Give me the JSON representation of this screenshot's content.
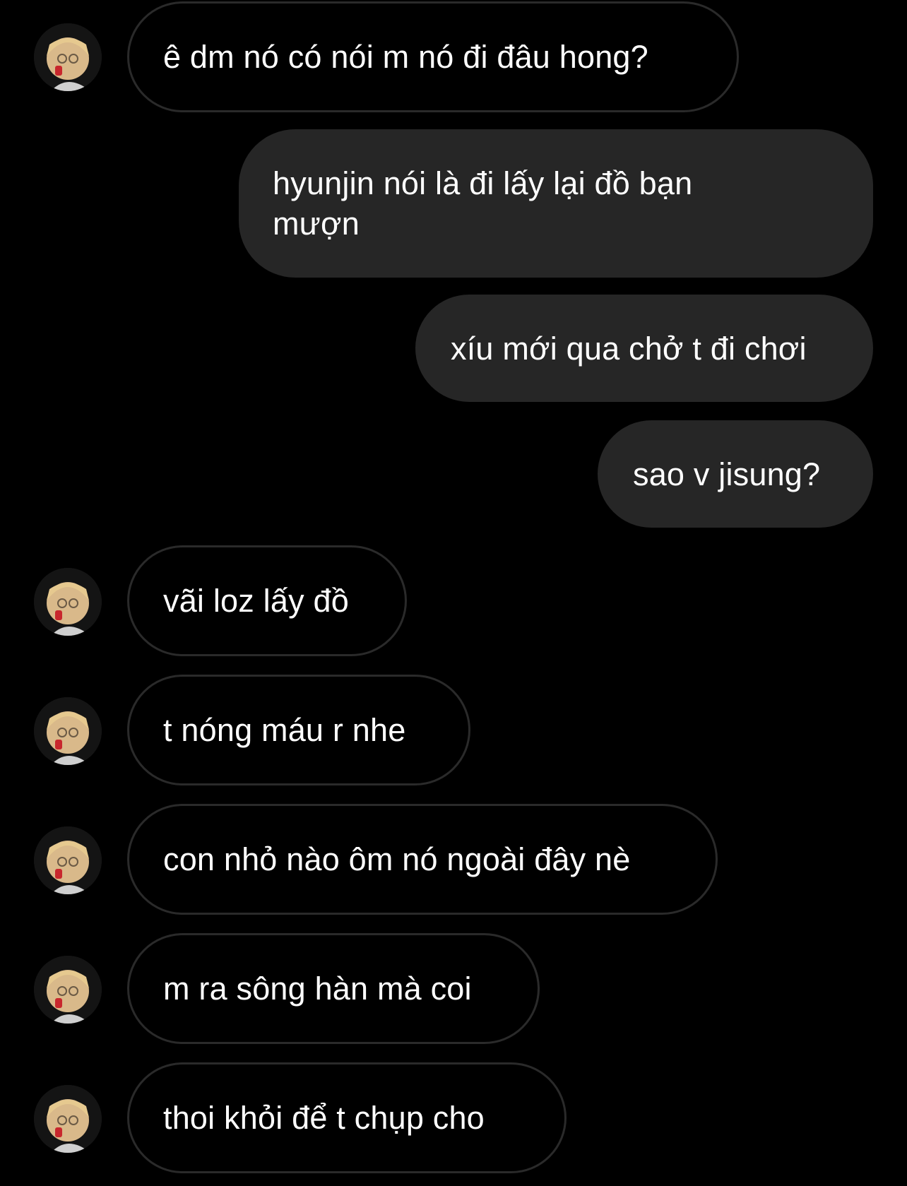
{
  "colors": {
    "background": "#000000",
    "incoming_border": "#2a2a2a",
    "outgoing_fill": "#262626",
    "text": "#ffffff"
  },
  "avatar": {
    "icon": "contact-avatar-icon"
  },
  "messages": [
    {
      "direction": "incoming",
      "text": "ê dm nó có nói m nó đi đâu hong?"
    },
    {
      "direction": "outgoing",
      "text": "hyunjin nói là đi lấy lại đồ bạn mượn"
    },
    {
      "direction": "outgoing",
      "text": "xíu mới qua chở t đi chơi"
    },
    {
      "direction": "outgoing",
      "text": "sao v jisung?"
    },
    {
      "direction": "incoming",
      "text": "vãi loz lấy đồ"
    },
    {
      "direction": "incoming",
      "text": "t nóng máu r nhe"
    },
    {
      "direction": "incoming",
      "text": "con nhỏ nào ôm nó ngoài đây nè"
    },
    {
      "direction": "incoming",
      "text": "m ra sông hàn mà coi"
    },
    {
      "direction": "incoming",
      "text": "thoi khỏi để t chụp cho"
    }
  ]
}
